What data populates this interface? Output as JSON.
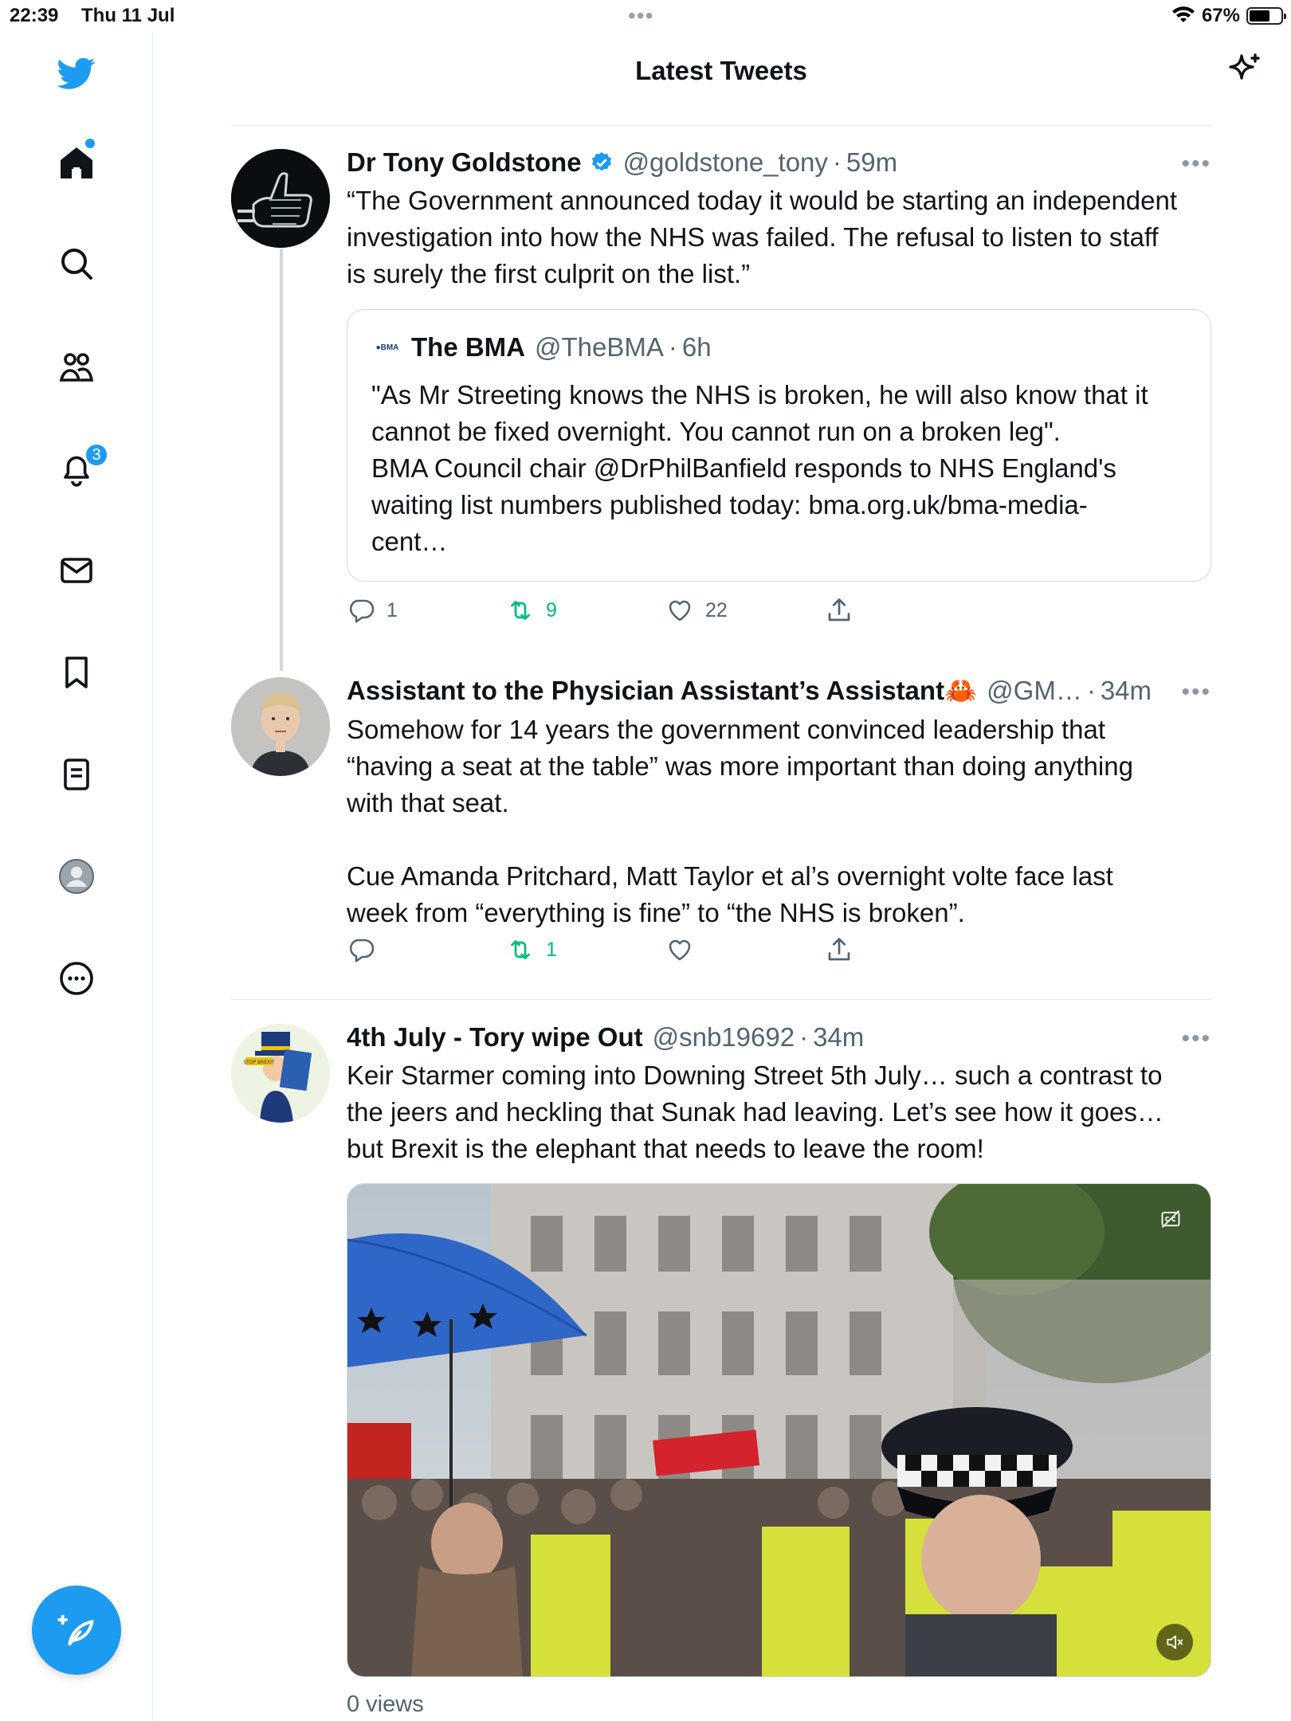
{
  "status_bar": {
    "time": "22:39",
    "date": "Thu 11 Jul",
    "battery": "67%",
    "battery_level": 0.67
  },
  "sidebar": {
    "items": [
      "twitter-logo",
      "home",
      "search",
      "communities",
      "notifications",
      "messages",
      "bookmarks",
      "lists",
      "profile",
      "more"
    ],
    "notifications_badge": "3"
  },
  "header": {
    "title": "Latest Tweets"
  },
  "tweets": [
    {
      "name": "Dr Tony Goldstone",
      "verified": true,
      "handle": "@goldstone_tony",
      "time": "59m",
      "text": [
        "“The Government announced today it would be starting an independent",
        "investigation into how the NHS was failed. The refusal to listen to staff",
        "is surely the first culprit on the list.”"
      ],
      "quote": {
        "logo_text": "BMA",
        "name": "The BMA",
        "handle": "@TheBMA",
        "time": "6h",
        "text": [
          "\"As Mr Streeting knows the NHS is broken, he will also know that it",
          "cannot be fixed overnight. You cannot run on a broken leg\".",
          "BMA Council chair @DrPhilBanfield responds to NHS England's",
          "waiting list numbers published today: bma.org.uk/bma-media-",
          "cent…"
        ]
      },
      "replies": "1",
      "retweets": "9",
      "likes": "22"
    },
    {
      "name": "Assistant to the Physician Assistant’s Assistant🦀",
      "handle": "@GM…",
      "time": "34m",
      "text": [
        "Somehow for 14 years the government convinced leadership that",
        "“having a seat at the table” was more important than doing anything",
        "with that seat.",
        "",
        "Cue Amanda Pritchard, Matt Taylor et al’s overnight volte face last",
        "week from “everything is fine” to “the NHS is broken”."
      ],
      "replies": "",
      "retweets": "1",
      "likes": ""
    },
    {
      "name": "4th July - Tory wipe Out",
      "handle": "@snb19692",
      "time": "34m",
      "text": [
        "Keir Starmer coming into Downing Street 5th July… such a contrast to",
        "the jeers and heckling that Sunak had leaving. Let’s see how it goes…",
        "but Brexit is the elephant that needs to leave the room!"
      ],
      "media": {
        "placard_text": "STOP BREXIT"
      },
      "views": "0 views"
    }
  ],
  "colors": {
    "brand": "#1d9bf0",
    "retweet": "#00ba7c",
    "secondary_text": "#536471",
    "divider": "#e6ecf0"
  }
}
